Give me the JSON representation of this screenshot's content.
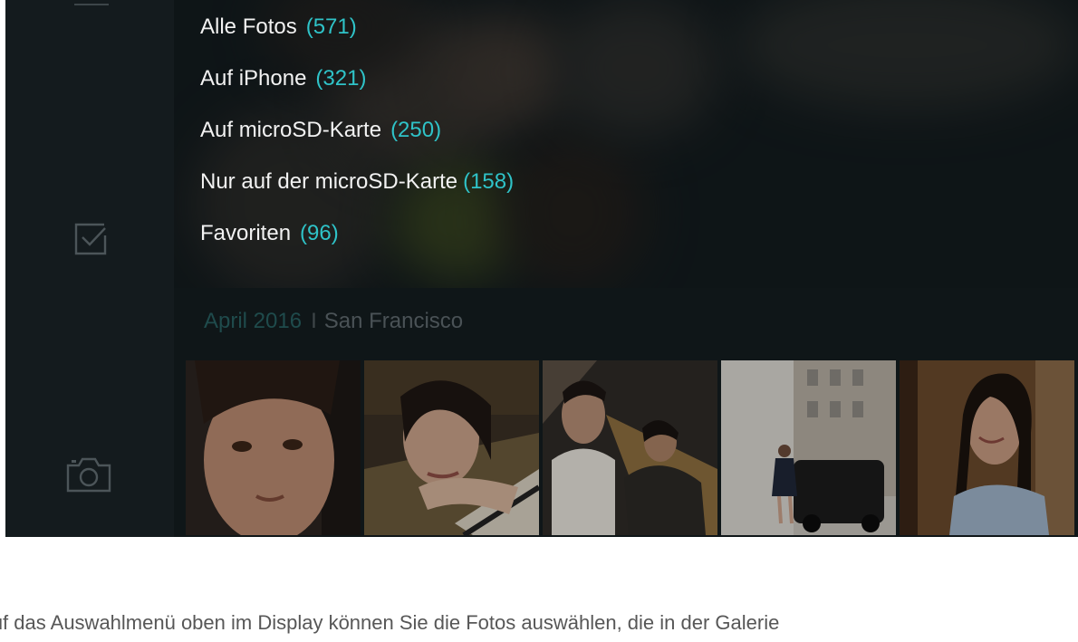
{
  "menu": {
    "items": [
      {
        "label": "Alle Fotos",
        "count": "(571)"
      },
      {
        "label": "Auf iPhone",
        "count": "(321)"
      },
      {
        "label": "Auf microSD-Karte",
        "count": "(250)"
      },
      {
        "label": "Nur auf der microSD-Karte",
        "count": "(158)"
      },
      {
        "label": "Favoriten",
        "count": "(96)"
      }
    ]
  },
  "sidebar": {
    "icons": [
      "menu-icon",
      "select-checkbox-icon",
      "camera-icon"
    ]
  },
  "gallery": {
    "section_date": "April 2016",
    "separator": "I",
    "section_location": "San Francisco",
    "photos": [
      "portrait-child",
      "woman-resting-on-hands",
      "couple-on-stairs",
      "woman-by-taxi-street",
      "woman-portrait-window"
    ]
  },
  "caption": {
    "text": "en auf das Auswahlmenü oben im Display können Sie die Fotos auswählen, die in der Galerie"
  },
  "colors": {
    "accent": "#2fc3c8",
    "background": "#0d1315",
    "sidebar": "#141b1e",
    "menu_text": "#f2f2f2"
  }
}
